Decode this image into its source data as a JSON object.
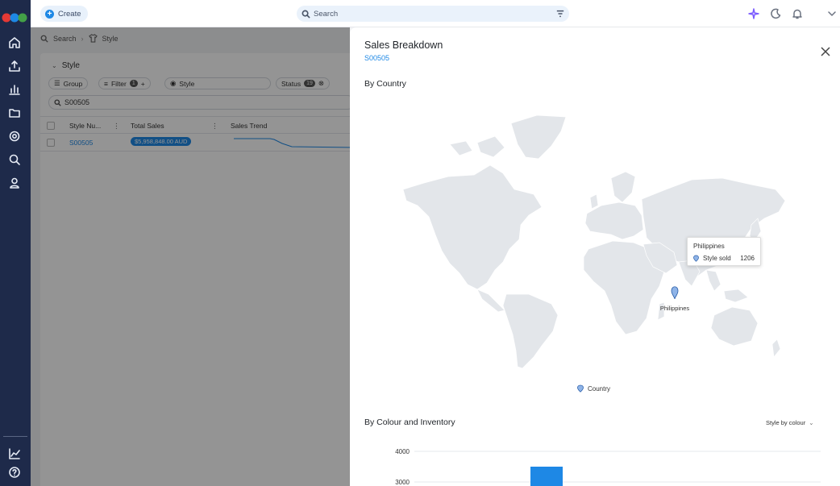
{
  "topbar": {
    "create_label": "Create",
    "search_placeholder": "Search"
  },
  "breadcrumb": {
    "items": [
      "Search",
      "Style"
    ]
  },
  "background_table": {
    "card_title": "Style",
    "chips": {
      "group": "Group",
      "filter": "Filter",
      "filter_count": "1",
      "view": "Style",
      "status": "Status",
      "status_count": "19"
    },
    "search_value": "S00505",
    "columns": [
      "Style Nu...",
      "Total Sales",
      "Sales Trend"
    ],
    "rows": [
      {
        "style_number": "S00505",
        "total_sales": "$5,958,848.00 AUD"
      }
    ]
  },
  "drawer": {
    "title": "Sales Breakdown",
    "subtitle": "S00505",
    "section_country": "By Country",
    "map": {
      "marker_label": "Philippines",
      "tooltip_title": "Philippines",
      "tooltip_metric": "Style sold",
      "tooltip_value": "1206",
      "legend_label": "Country"
    },
    "section_colour": "By Colour and Inventory",
    "style_select": "Style by colour"
  },
  "colors": {
    "accent": "#1e88e5",
    "rail": "#1e2a4a",
    "land": "#e3e6ea"
  },
  "chart_data": {
    "type": "bar",
    "y_ticks": [
      4000,
      3000
    ],
    "values": [
      3500
    ]
  }
}
